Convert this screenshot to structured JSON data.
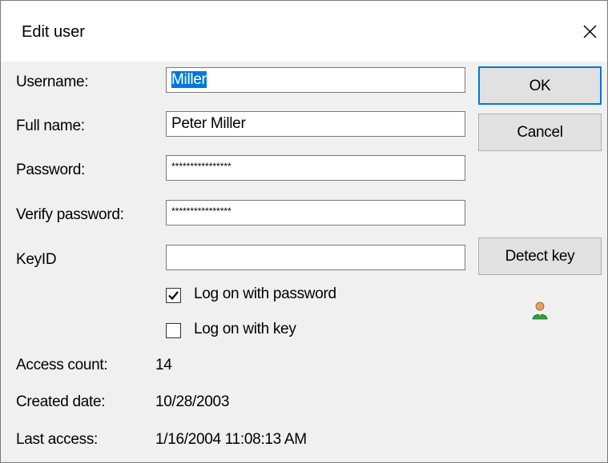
{
  "dialog": {
    "title": "Edit user",
    "close_icon": "close-icon"
  },
  "fields": {
    "username_label": "Username:",
    "username_value": "Miller",
    "fullname_label": "Full name:",
    "fullname_value": "Peter Miller",
    "password_label": "Password:",
    "password_value": "****************",
    "verify_label": "Verify password:",
    "verify_value": "****************",
    "keyid_label": "KeyID",
    "keyid_value": ""
  },
  "buttons": {
    "ok": "OK",
    "cancel": "Cancel",
    "detect_key": "Detect key"
  },
  "options": {
    "logon_password_label": "Log on with password",
    "logon_password_checked": true,
    "logon_key_label": "Log on with key",
    "logon_key_checked": false
  },
  "stats": {
    "access_count_label": "Access count:",
    "access_count_value": "14",
    "created_label": "Created date:",
    "created_value": "10/28/2003",
    "last_access_label": "Last access:",
    "last_access_value": "1/16/2004 11:08:13 AM"
  },
  "icons": {
    "user_status": "user-icon"
  },
  "colors": {
    "selection": "#0078d7",
    "user_icon_green": "#2e9e3e",
    "user_icon_skin": "#e8a060"
  }
}
